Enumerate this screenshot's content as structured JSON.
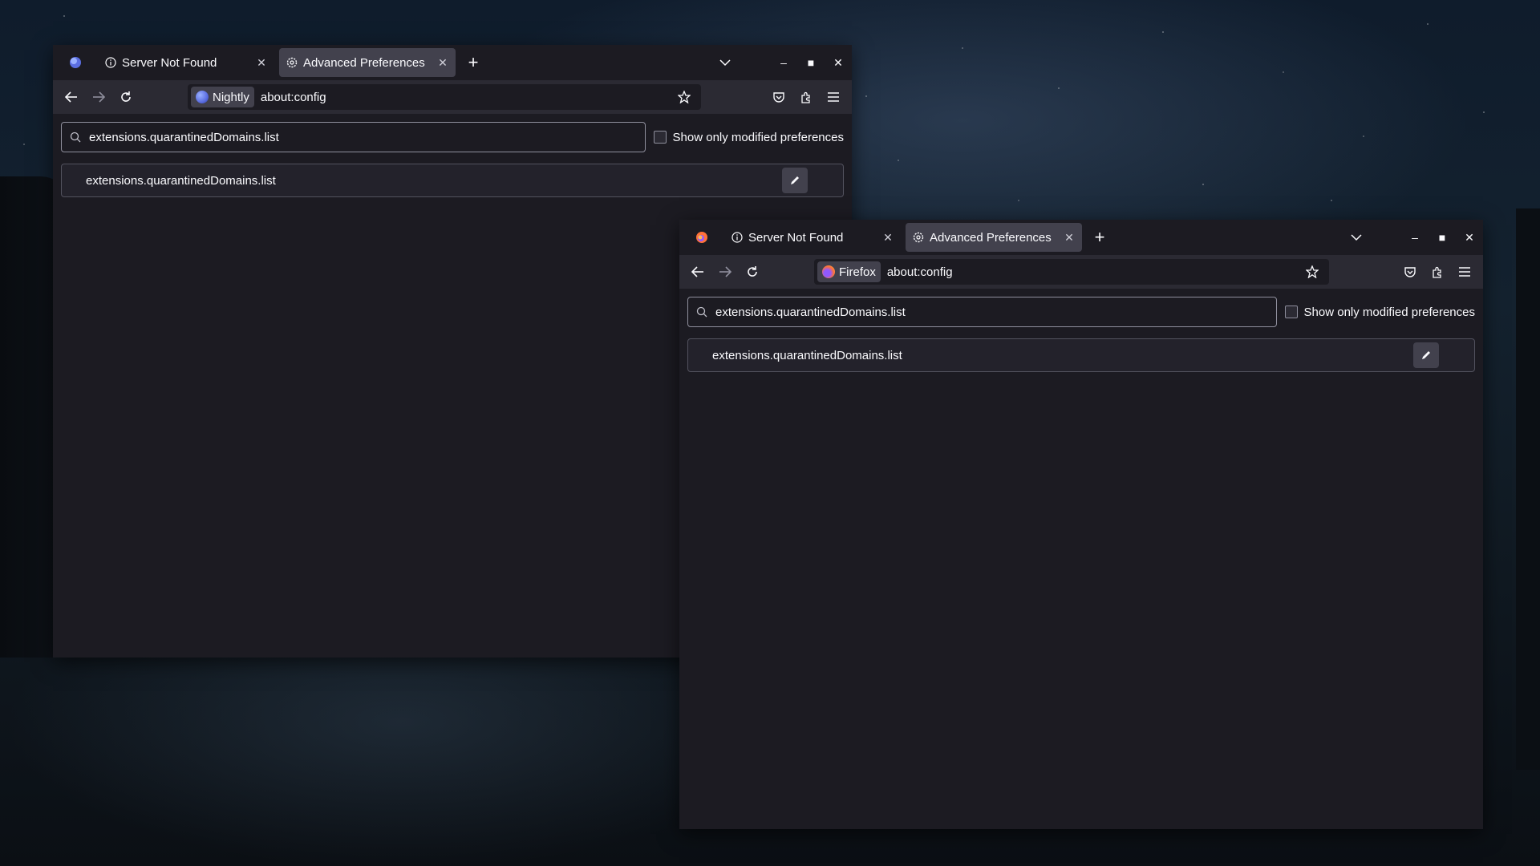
{
  "windows": [
    {
      "brand": "Nightly",
      "tabs": [
        {
          "label": "Server Not Found",
          "icon": "info-icon",
          "active": false
        },
        {
          "label": "Advanced Preferences",
          "icon": "gear-icon",
          "active": true
        }
      ],
      "url": "about:config",
      "search_value": "extensions.quarantinedDomains.list",
      "checkbox_label": "Show only modified preferences",
      "pref_name": "extensions.quarantinedDomains.list"
    },
    {
      "brand": "Firefox",
      "tabs": [
        {
          "label": "Server Not Found",
          "icon": "info-icon",
          "active": false
        },
        {
          "label": "Advanced Preferences",
          "icon": "gear-icon",
          "active": true
        }
      ],
      "url": "about:config",
      "search_value": "extensions.quarantinedDomains.list",
      "checkbox_label": "Show only modified preferences",
      "pref_name": "extensions.quarantinedDomains.list"
    }
  ],
  "colors": {
    "nightly_logo": "#5b6ee1",
    "firefox_logo": "#ff7139",
    "accent_bg": "#1c1b22"
  }
}
